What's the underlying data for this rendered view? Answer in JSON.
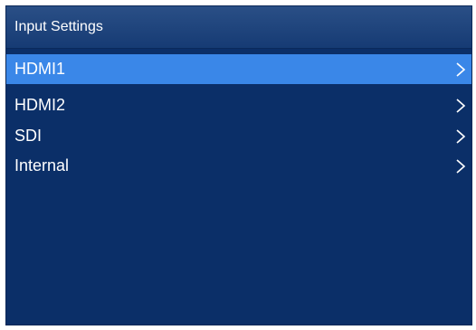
{
  "header": {
    "title": "Input Settings"
  },
  "menu": {
    "items": [
      {
        "label": "HDMI1",
        "selected": true
      },
      {
        "label": "HDMI2",
        "selected": false
      },
      {
        "label": "SDI",
        "selected": false
      },
      {
        "label": "Internal",
        "selected": false
      }
    ]
  },
  "colors": {
    "panel_bg": "#0b2f68",
    "header_bg": "#1d437b",
    "selected_bg": "#3a87e8",
    "text": "#ffffff"
  },
  "icons": {
    "item_arrow": "chevron-right-icon"
  }
}
